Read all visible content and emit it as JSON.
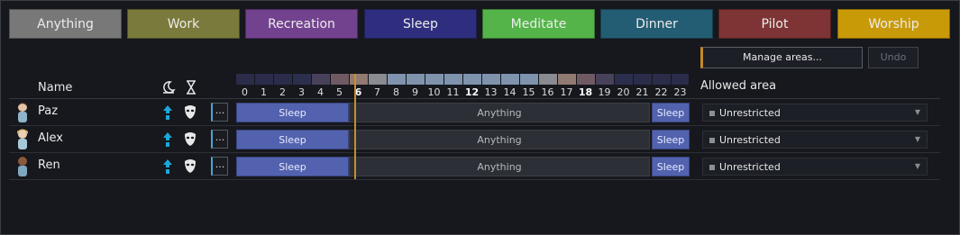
{
  "palette": [
    {
      "label": "Anything",
      "color": "#787878"
    },
    {
      "label": "Work",
      "color": "#7a7a3c"
    },
    {
      "label": "Recreation",
      "color": "#73428f"
    },
    {
      "label": "Sleep",
      "color": "#2f2e7e"
    },
    {
      "label": "Meditate",
      "color": "#54b449"
    },
    {
      "label": "Dinner",
      "color": "#235d74"
    },
    {
      "label": "Pilot",
      "color": "#7e3434"
    },
    {
      "label": "Worship",
      "color": "#c99a08"
    }
  ],
  "toolbar": {
    "manage_label": "Manage areas...",
    "undo_label": "Undo"
  },
  "header": {
    "name_label": "Name",
    "allowed_area_label": "Allowed area"
  },
  "hours": [
    "0",
    "1",
    "2",
    "3",
    "4",
    "5",
    "6",
    "7",
    "8",
    "9",
    "10",
    "11",
    "12",
    "13",
    "14",
    "15",
    "16",
    "17",
    "18",
    "19",
    "20",
    "21",
    "22",
    "23"
  ],
  "current_hour": 6,
  "colonists": [
    {
      "name": "Paz",
      "area": "Unrestricted",
      "schedule": [
        {
          "label": "Sleep",
          "type": "sleep",
          "start": 0,
          "end": 6
        },
        {
          "label": "Anything",
          "type": "anything",
          "start": 6,
          "end": 22
        },
        {
          "label": "Sleep",
          "type": "sleep",
          "start": 22,
          "end": 24
        }
      ]
    },
    {
      "name": "Alex",
      "area": "Unrestricted",
      "schedule": [
        {
          "label": "Sleep",
          "type": "sleep",
          "start": 0,
          "end": 6
        },
        {
          "label": "Anything",
          "type": "anything",
          "start": 6,
          "end": 22
        },
        {
          "label": "Sleep",
          "type": "sleep",
          "start": 22,
          "end": 24
        }
      ]
    },
    {
      "name": "Ren",
      "area": "Unrestricted",
      "schedule": [
        {
          "label": "Sleep",
          "type": "sleep",
          "start": 0,
          "end": 6
        },
        {
          "label": "Anything",
          "type": "anything",
          "start": 6,
          "end": 22
        },
        {
          "label": "Sleep",
          "type": "sleep",
          "start": 22,
          "end": 24
        }
      ]
    }
  ],
  "row_button_label": "...",
  "icons": {
    "sleep_header": "moon-icon",
    "time_header": "hourglass-icon",
    "priority": "up-arrow-icon",
    "mask": "mask-icon"
  }
}
